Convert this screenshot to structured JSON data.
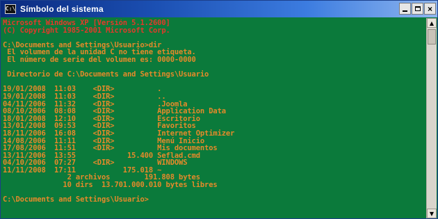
{
  "window": {
    "title": "Símbolo del sistema",
    "icon_label": "C:\\",
    "controls": {
      "minimize": "_",
      "maximize": "□",
      "close": "×"
    }
  },
  "console": {
    "lines": [
      {
        "text": "Microsoft Windows XP [Versión 5.1.2600]",
        "color": "red"
      },
      {
        "text": "(C) Copyright 1985-2001 Microsoft Corp.",
        "color": "red"
      },
      {
        "text": "",
        "color": "orange"
      },
      {
        "text": "C:\\Documents and Settings\\Usuario>dir",
        "color": "orange"
      },
      {
        "text": " El volumen de la unidad C no tiene etiqueta.",
        "color": "orange"
      },
      {
        "text": " El número de serie del volumen es: 0000-0000",
        "color": "orange"
      },
      {
        "text": "",
        "color": "orange"
      },
      {
        "text": " Directorio de C:\\Documents and Settings\\Usuario",
        "color": "orange"
      },
      {
        "text": "",
        "color": "orange"
      },
      {
        "text": "19/01/2008  11:03    <DIR>          .",
        "color": "orange"
      },
      {
        "text": "19/01/2008  11:03    <DIR>          ..",
        "color": "orange"
      },
      {
        "text": "04/11/2006  11:32    <DIR>          .Joomla",
        "color": "orange"
      },
      {
        "text": "08/10/2006  08:08    <DIR>          Application Data",
        "color": "orange"
      },
      {
        "text": "18/01/2008  12:10    <DIR>          Escritorio",
        "color": "orange"
      },
      {
        "text": "13/01/2008  09:53    <DIR>          Favoritos",
        "color": "orange"
      },
      {
        "text": "18/11/2006  16:08    <DIR>          Internet Optimizer",
        "color": "orange"
      },
      {
        "text": "14/08/2006  11:11    <DIR>          Menú Inicio",
        "color": "orange"
      },
      {
        "text": "17/08/2006  11:51    <DIR>          Mis documentos",
        "color": "orange"
      },
      {
        "text": "13/11/2006  13:55            15.400 Seflad.cmd",
        "color": "orange"
      },
      {
        "text": "04/10/2006  07:27    <DIR>          WINDOWS",
        "color": "orange"
      },
      {
        "text": "11/11/2008  17:11           175.018 ~",
        "color": "orange"
      },
      {
        "text": "               2 archivos        191.808 bytes",
        "color": "orange"
      },
      {
        "text": "              10 dirs  13.701.000.010 bytes libres",
        "color": "orange"
      },
      {
        "text": "",
        "color": "orange"
      },
      {
        "text": "C:\\Documents and Settings\\Usuario>",
        "color": "orange"
      }
    ]
  },
  "scrollbar": {
    "up": "▲",
    "down": "▼"
  }
}
